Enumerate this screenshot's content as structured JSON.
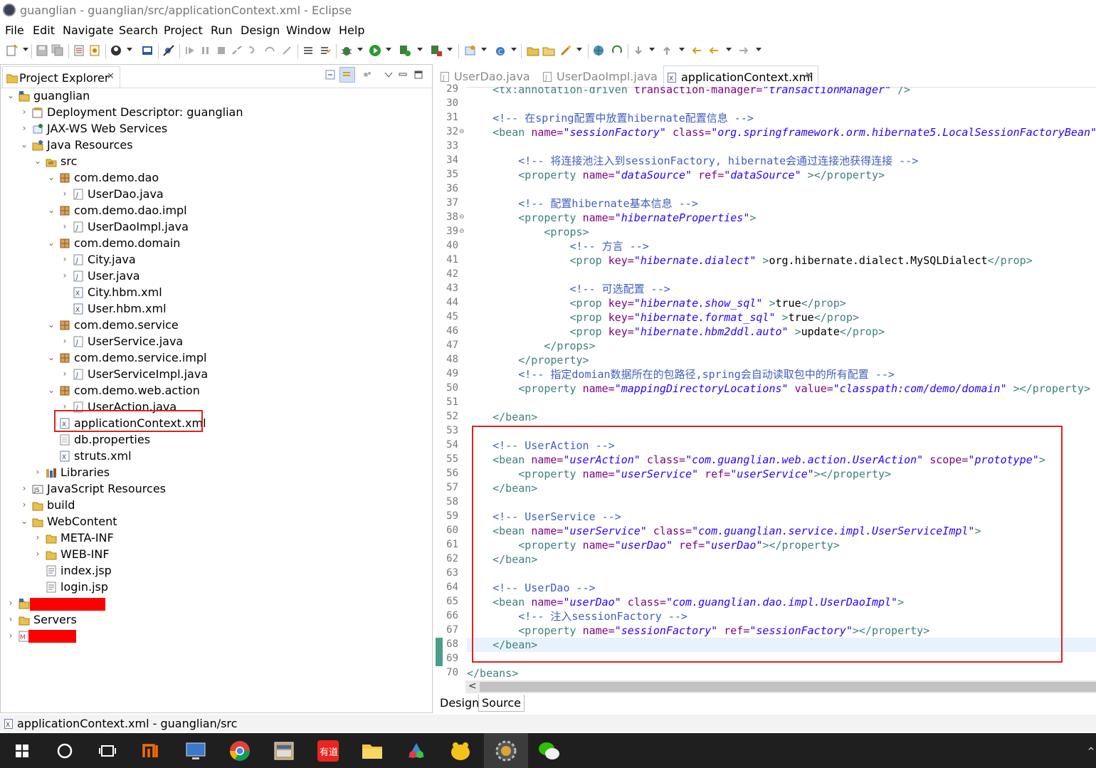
{
  "window": {
    "title": "guanglian - guanglian/src/applicationContext.xml - Eclipse"
  },
  "menu": [
    "File",
    "Edit",
    "Navigate",
    "Search",
    "Project",
    "Run",
    "Design",
    "Window",
    "Help"
  ],
  "explorer": {
    "tab_label": "Project Explorer",
    "close_glyph": "✕",
    "tree": [
      {
        "label": "guanglian",
        "arrow": "⌄",
        "icon": "project-icon"
      },
      {
        "label": "Deployment Descriptor: guanglian",
        "arrow": "›",
        "icon": "deployment-descriptor-icon"
      },
      {
        "label": "JAX-WS Web Services",
        "arrow": "›",
        "icon": "web-services-icon"
      },
      {
        "label": "Java Resources",
        "arrow": "⌄",
        "icon": "java-resources-icon"
      },
      {
        "label": "src",
        "arrow": "⌄",
        "icon": "source-folder-icon"
      },
      {
        "label": "com.demo.dao",
        "arrow": "⌄",
        "icon": "package-icon"
      },
      {
        "label": "UserDao.java",
        "arrow": "›",
        "icon": "java-file-icon"
      },
      {
        "label": "com.demo.dao.impl",
        "arrow": "⌄",
        "icon": "package-icon"
      },
      {
        "label": "UserDaoImpl.java",
        "arrow": "›",
        "icon": "java-file-icon"
      },
      {
        "label": "com.demo.domain",
        "arrow": "⌄",
        "icon": "package-icon"
      },
      {
        "label": "City.java",
        "arrow": "›",
        "icon": "java-file-icon"
      },
      {
        "label": "User.java",
        "arrow": "›",
        "icon": "java-file-icon"
      },
      {
        "label": "City.hbm.xml",
        "arrow": "",
        "icon": "xml-file-icon"
      },
      {
        "label": "User.hbm.xml",
        "arrow": "",
        "icon": "xml-file-icon"
      },
      {
        "label": "com.demo.service",
        "arrow": "⌄",
        "icon": "package-icon"
      },
      {
        "label": "UserService.java",
        "arrow": "›",
        "icon": "java-file-icon"
      },
      {
        "label": "com.demo.service.impl",
        "arrow": "⌄",
        "icon": "package-icon"
      },
      {
        "label": "UserServiceImpl.java",
        "arrow": "›",
        "icon": "java-file-icon"
      },
      {
        "label": "com.demo.web.action",
        "arrow": "⌄",
        "icon": "package-icon"
      },
      {
        "label": "UserAction.java",
        "arrow": "›",
        "icon": "java-file-icon"
      },
      {
        "label": "applicationContext.xml",
        "arrow": "",
        "icon": "xml-file-icon"
      },
      {
        "label": "db.properties",
        "arrow": "",
        "icon": "properties-file-icon"
      },
      {
        "label": "struts.xml",
        "arrow": "",
        "icon": "xml-file-icon"
      },
      {
        "label": "Libraries",
        "arrow": "›",
        "icon": "libraries-icon"
      },
      {
        "label": "JavaScript Resources",
        "arrow": "›",
        "icon": "javascript-resources-icon"
      },
      {
        "label": "build",
        "arrow": "›",
        "icon": "folder-icon"
      },
      {
        "label": "WebContent",
        "arrow": "⌄",
        "icon": "folder-icon"
      },
      {
        "label": "META-INF",
        "arrow": "›",
        "icon": "folder-icon"
      },
      {
        "label": "WEB-INF",
        "arrow": "›",
        "icon": "folder-icon"
      },
      {
        "label": "index.jsp",
        "arrow": "",
        "icon": "jsp-file-icon"
      },
      {
        "label": "login.jsp",
        "arrow": "",
        "icon": "jsp-file-icon"
      },
      {
        "label": "",
        "arrow": "›",
        "icon": "project-icon"
      },
      {
        "label": "Servers",
        "arrow": "›",
        "icon": "folder-icon"
      },
      {
        "label": "",
        "arrow": "›",
        "icon": "maven-project-icon"
      }
    ]
  },
  "editor": {
    "tabs": [
      {
        "label": "UserDao.java",
        "active": false
      },
      {
        "label": "UserDaoImpl.java",
        "active": false
      },
      {
        "label": "applicationContext.xml",
        "active": true
      }
    ],
    "lines": [
      {
        "n": "29",
        "fold": "",
        "parts": [
          [
            "t",
            "    <tx:annotation-driven "
          ],
          [
            "a",
            "transaction-manager="
          ],
          [
            "v",
            "\"transactionManager\""
          ],
          [
            "t",
            " />"
          ]
        ]
      },
      {
        "n": "30",
        "fold": "",
        "parts": []
      },
      {
        "n": "31",
        "fold": "",
        "parts": [
          [
            "c",
            "    <!-- 在spring配置中放置hibernate配置信息 -->"
          ]
        ]
      },
      {
        "n": "32",
        "fold": "⊖",
        "parts": [
          [
            "t",
            "    <bean "
          ],
          [
            "a",
            "name="
          ],
          [
            "v",
            "\"sessionFactory\""
          ],
          [
            "t",
            " "
          ],
          [
            "a",
            "class="
          ],
          [
            "v",
            "\"org.springframework.orm.hibernate5.LocalSessionFactoryBean\""
          ],
          [
            "t",
            " >"
          ]
        ]
      },
      {
        "n": "33",
        "fold": "",
        "parts": []
      },
      {
        "n": "34",
        "fold": "",
        "parts": [
          [
            "c",
            "        <!-- 将连接池注入到sessionFactory, hibernate会通过连接池获得连接 -->"
          ]
        ]
      },
      {
        "n": "35",
        "fold": "",
        "parts": [
          [
            "t",
            "        <property "
          ],
          [
            "a",
            "name="
          ],
          [
            "v",
            "\"dataSource\""
          ],
          [
            "t",
            " "
          ],
          [
            "a",
            "ref="
          ],
          [
            "v",
            "\"dataSource\""
          ],
          [
            "t",
            " ></property>"
          ]
        ]
      },
      {
        "n": "36",
        "fold": "",
        "parts": []
      },
      {
        "n": "37",
        "fold": "",
        "parts": [
          [
            "c",
            "        <!-- 配置hibernate基本信息 -->"
          ]
        ]
      },
      {
        "n": "38",
        "fold": "⊖",
        "parts": [
          [
            "t",
            "        <property "
          ],
          [
            "a",
            "name="
          ],
          [
            "v",
            "\"hibernateProperties\""
          ],
          [
            "t",
            ">"
          ]
        ]
      },
      {
        "n": "39",
        "fold": "⊖",
        "parts": [
          [
            "t",
            "            <props>"
          ]
        ]
      },
      {
        "n": "40",
        "fold": "",
        "parts": [
          [
            "c",
            "                <!-- 方言 -->"
          ]
        ]
      },
      {
        "n": "41",
        "fold": "",
        "parts": [
          [
            "t",
            "                <prop "
          ],
          [
            "a",
            "key="
          ],
          [
            "v",
            "\"hibernate.dialect\""
          ],
          [
            "t",
            " >"
          ],
          [
            "x",
            "org.hibernate.dialect.MySQLDialect"
          ],
          [
            "t",
            "</prop>"
          ]
        ]
      },
      {
        "n": "42",
        "fold": "",
        "parts": []
      },
      {
        "n": "43",
        "fold": "",
        "parts": [
          [
            "c",
            "                <!-- 可选配置 -->"
          ]
        ]
      },
      {
        "n": "44",
        "fold": "",
        "parts": [
          [
            "t",
            "                <prop "
          ],
          [
            "a",
            "key="
          ],
          [
            "v",
            "\"hibernate.show_sql\""
          ],
          [
            "t",
            " >"
          ],
          [
            "x",
            "true"
          ],
          [
            "t",
            "</prop>"
          ]
        ]
      },
      {
        "n": "45",
        "fold": "",
        "parts": [
          [
            "t",
            "                <prop "
          ],
          [
            "a",
            "key="
          ],
          [
            "v",
            "\"hibernate.format_sql\""
          ],
          [
            "t",
            " >"
          ],
          [
            "x",
            "true"
          ],
          [
            "t",
            "</prop>"
          ]
        ]
      },
      {
        "n": "46",
        "fold": "",
        "parts": [
          [
            "t",
            "                <prop "
          ],
          [
            "a",
            "key="
          ],
          [
            "v",
            "\"hibernate.hbm2ddl.auto\""
          ],
          [
            "t",
            " >"
          ],
          [
            "x",
            "update"
          ],
          [
            "t",
            "</prop>"
          ]
        ]
      },
      {
        "n": "47",
        "fold": "",
        "parts": [
          [
            "t",
            "            </props>"
          ]
        ]
      },
      {
        "n": "48",
        "fold": "",
        "parts": [
          [
            "t",
            "        </property>"
          ]
        ]
      },
      {
        "n": "49",
        "fold": "",
        "parts": [
          [
            "c",
            "        <!-- 指定domian数据所在的包路径,spring会自动读取包中的所有配置 -->"
          ]
        ]
      },
      {
        "n": "50",
        "fold": "",
        "parts": [
          [
            "t",
            "        <property "
          ],
          [
            "a",
            "name="
          ],
          [
            "v",
            "\"mappingDirectoryLocations\""
          ],
          [
            "t",
            " "
          ],
          [
            "a",
            "value="
          ],
          [
            "v",
            "\"classpath:com/demo/domain\""
          ],
          [
            "t",
            " ></property>"
          ]
        ]
      },
      {
        "n": "51",
        "fold": "",
        "parts": []
      },
      {
        "n": "52",
        "fold": "",
        "parts": [
          [
            "t",
            "    </bean>"
          ]
        ]
      },
      {
        "n": "53",
        "fold": "",
        "parts": []
      },
      {
        "n": "54",
        "fold": "",
        "parts": [
          [
            "c",
            "    <!-- UserAction -->"
          ]
        ]
      },
      {
        "n": "55",
        "fold": "",
        "parts": [
          [
            "t",
            "    <bean "
          ],
          [
            "a",
            "name="
          ],
          [
            "v",
            "\"userAction\""
          ],
          [
            "t",
            " "
          ],
          [
            "a",
            "class="
          ],
          [
            "v",
            "\"com.guanglian.web.action.UserAction\""
          ],
          [
            "t",
            " "
          ],
          [
            "a",
            "scope="
          ],
          [
            "v",
            "\"prototype\""
          ],
          [
            "t",
            ">"
          ]
        ]
      },
      {
        "n": "56",
        "fold": "",
        "parts": [
          [
            "t",
            "        <property "
          ],
          [
            "a",
            "name="
          ],
          [
            "v",
            "\"userService\""
          ],
          [
            "t",
            " "
          ],
          [
            "a",
            "ref="
          ],
          [
            "v",
            "\"userService\""
          ],
          [
            "t",
            "></property>"
          ]
        ]
      },
      {
        "n": "57",
        "fold": "",
        "parts": [
          [
            "t",
            "    </bean>"
          ]
        ]
      },
      {
        "n": "58",
        "fold": "",
        "parts": []
      },
      {
        "n": "59",
        "fold": "",
        "parts": [
          [
            "c",
            "    <!-- UserService -->"
          ]
        ]
      },
      {
        "n": "60",
        "fold": "",
        "parts": [
          [
            "t",
            "    <bean "
          ],
          [
            "a",
            "name="
          ],
          [
            "v",
            "\"userService\""
          ],
          [
            "t",
            " "
          ],
          [
            "a",
            "class="
          ],
          [
            "v",
            "\"com.guanglian.service.impl.UserServiceImpl\""
          ],
          [
            "t",
            ">"
          ]
        ]
      },
      {
        "n": "61",
        "fold": "",
        "parts": [
          [
            "t",
            "        <property "
          ],
          [
            "a",
            "name="
          ],
          [
            "v",
            "\"userDao\""
          ],
          [
            "t",
            " "
          ],
          [
            "a",
            "ref="
          ],
          [
            "v",
            "\"userDao\""
          ],
          [
            "t",
            "></property>"
          ]
        ]
      },
      {
        "n": "62",
        "fold": "",
        "parts": [
          [
            "t",
            "    </bean>"
          ]
        ]
      },
      {
        "n": "63",
        "fold": "",
        "parts": []
      },
      {
        "n": "64",
        "fold": "",
        "parts": [
          [
            "c",
            "    <!-- UserDao -->"
          ]
        ]
      },
      {
        "n": "65",
        "fold": "",
        "parts": [
          [
            "t",
            "    <bean "
          ],
          [
            "a",
            "name="
          ],
          [
            "v",
            "\"userDao\""
          ],
          [
            "t",
            " "
          ],
          [
            "a",
            "class="
          ],
          [
            "v",
            "\"com.guanglian.dao.impl.UserDaoImpl\""
          ],
          [
            "t",
            ">"
          ]
        ]
      },
      {
        "n": "66",
        "fold": "",
        "parts": [
          [
            "c",
            "        <!-- 注入sessionFactory -->"
          ]
        ]
      },
      {
        "n": "67",
        "fold": "",
        "parts": [
          [
            "t",
            "        <property "
          ],
          [
            "a",
            "name="
          ],
          [
            "v",
            "\"sessionFactory\""
          ],
          [
            "t",
            " "
          ],
          [
            "a",
            "ref="
          ],
          [
            "v",
            "\"sessionFactory\""
          ],
          [
            "t",
            "></property>"
          ]
        ]
      },
      {
        "n": "68",
        "fold": "",
        "parts": [
          [
            "t",
            "    </bean>"
          ]
        ]
      },
      {
        "n": "69",
        "fold": "",
        "parts": []
      },
      {
        "n": "70",
        "fold": "",
        "parts": [
          [
            "t",
            "</beans>"
          ]
        ]
      }
    ],
    "mode_tabs": [
      "Design",
      "Source"
    ],
    "active_mode": "Source",
    "scroll_left_glyph": "<"
  },
  "status": {
    "text": "applicationContext.xml - guanglian/src"
  },
  "colors": {
    "tag": "#3f7f7f",
    "attribute": "#7f007f",
    "value": "#2a00ff",
    "comment": "#3f5fbf",
    "annotation_red": "#e02020",
    "taskbar": "#1f1f1f"
  },
  "taskbar": {
    "apps": [
      "windows-start-icon",
      "cortana-icon",
      "task-view-icon",
      "xiaomi-icon",
      "remote-desktop-icon",
      "chrome-icon",
      "file-manager-app-icon",
      "youdao-icon",
      "file-explorer-icon",
      "paint-app-icon",
      "chat-app-icon",
      "eclipse-icon",
      "wechat-icon"
    ],
    "youdao_label": "有道"
  }
}
